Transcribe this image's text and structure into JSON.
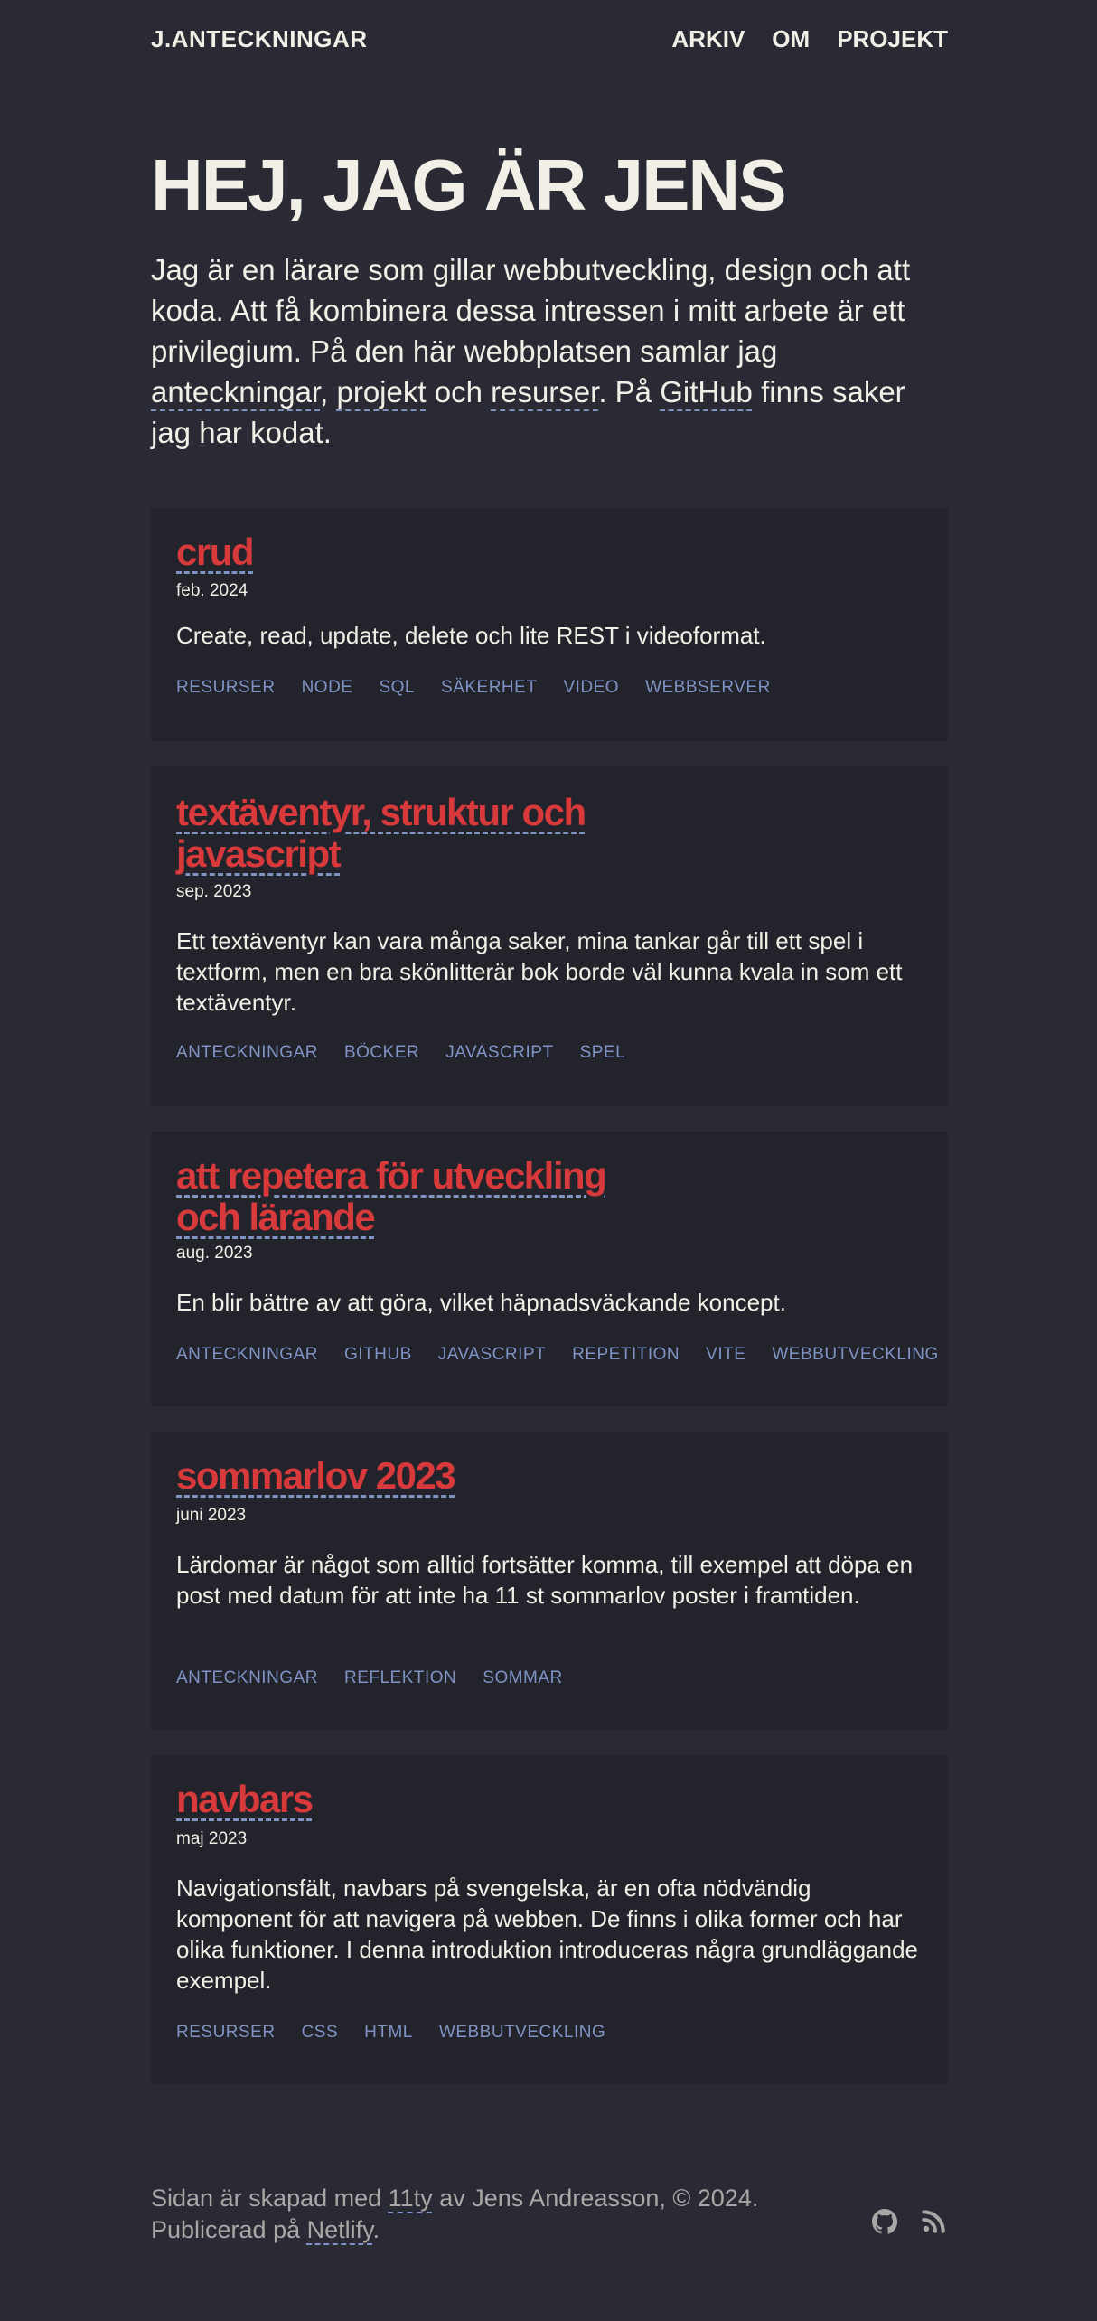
{
  "header": {
    "logo": "J.ANTECKNINGAR",
    "nav": [
      "ARKIV",
      "OM",
      "PROJEKT"
    ]
  },
  "hero": {
    "title": "HEJ, JAG ÄR JENS",
    "intro_text": "Jag är en lärare som gillar webbutveckling, design och att koda. Att få kombinera dessa intressen i mitt arbete är ett privilegium. På den här webbplatsen samlar jag",
    "link_anteckningar": "anteckningar",
    "sep_comma": ",",
    "link_projekt": "projekt",
    "word_och": "och",
    "link_resurser": "resurser",
    "text_pa": ". På",
    "link_github": "GitHub",
    "text_end": "finns saker jag har kodat."
  },
  "posts": [
    {
      "title": "crud",
      "date": "feb. 2024",
      "description": "Create, read, update, delete och lite REST i videoformat.",
      "tags": [
        "RESURSER",
        "NODE",
        "SQL",
        "SÄKERHET",
        "VIDEO",
        "WEBBSERVER"
      ]
    },
    {
      "title_lines": [
        "textäventyr, struktur och",
        "javascript"
      ],
      "date": "sep. 2023",
      "description": "Ett textäventyr kan vara många saker, mina tankar går till ett spel i textform, men en bra skönlitterär bok borde väl kunna kvala in som ett textäventyr.",
      "tags": [
        "ANTECKNINGAR",
        "BÖCKER",
        "JAVASCRIPT",
        "SPEL"
      ]
    },
    {
      "title_lines": [
        "att repetera för utveckling",
        "och lärande"
      ],
      "date": "aug. 2023",
      "description": "En blir bättre av att göra, vilket häpnadsväckande koncept.",
      "tags": [
        "ANTECKNINGAR",
        "GITHUB",
        "JAVASCRIPT",
        "REPETITION",
        "VITE",
        "WEBBUTVECKLING"
      ]
    },
    {
      "title": "sommarlov 2023",
      "date": "juni 2023",
      "description": "Lärdomar är något som alltid fortsätter komma, till exempel att döpa en post med datum för att inte ha 11 st sommarlov poster i framtiden.",
      "tags": [
        "ANTECKNINGAR",
        "REFLEKTION",
        "SOMMAR"
      ]
    },
    {
      "title": "navbars",
      "date": "maj 2023",
      "description": "Navigationsfält, navbars på svengelska, är en ofta nödvändig komponent för att navigera på webben. De finns i olika former och har olika funktioner. I denna introduktion introduceras några grundläggande exempel.",
      "tags": [
        "RESURSER",
        "CSS",
        "HTML",
        "WEBBUTVECKLING"
      ]
    }
  ],
  "footer": {
    "text_1": "Sidan är skapad med",
    "link_11ty": "11ty",
    "text_2": "av Jens Andreasson, © 2024.",
    "text_3": "Publicerad på",
    "link_netlify": "Netlify",
    "text_4": ".",
    "icons": [
      "github-icon",
      "rss-icon"
    ]
  },
  "colors": {
    "background": "#2a2a35",
    "card_background": "#23232c",
    "text": "#f2efe6",
    "accent_title": "#d83a3c",
    "tag_link": "#7f93c4",
    "footer_text": "#a9a7a5"
  }
}
